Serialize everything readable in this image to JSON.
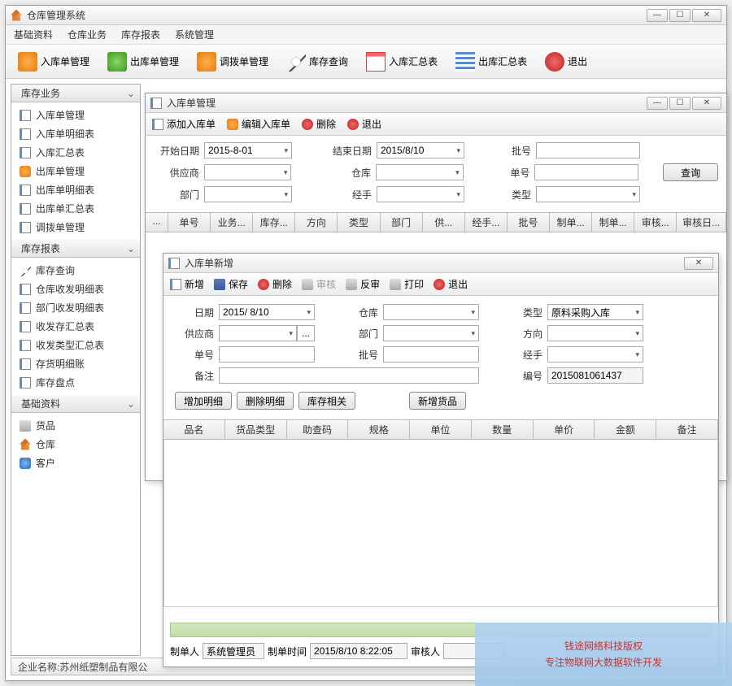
{
  "main": {
    "title": "仓库管理系统",
    "menu": [
      "基础资料",
      "仓库业务",
      "库存报表",
      "系统管理"
    ],
    "toolbar": [
      "入库单管理",
      "出库单管理",
      "调拨单管理",
      "库存查询",
      "入库汇总表",
      "出库汇总表",
      "退出"
    ],
    "statusbar": "企业名称:苏州纸塑制品有限公"
  },
  "sidebar": {
    "sections": [
      {
        "title": "库存业务",
        "items": [
          "入库单管理",
          "入库单明细表",
          "入库汇总表",
          "出库单管理",
          "出库单明细表",
          "出库单汇总表",
          "调拨单管理"
        ]
      },
      {
        "title": "库存报表",
        "items": [
          "库存查询",
          "仓库收发明细表",
          "部门收发明细表",
          "收发存汇总表",
          "收发类型汇总表",
          "存货明细账",
          "库存盘点"
        ]
      },
      {
        "title": "基础资料",
        "items": [
          "货品",
          "仓库",
          "客户"
        ]
      }
    ]
  },
  "win2": {
    "title": "入库单管理",
    "toolbar": [
      "添加入库单",
      "编辑入库单",
      "删除",
      "退出"
    ],
    "labels": {
      "start": "开始日期",
      "end": "结束日期",
      "batch": "批号",
      "supplier": "供应商",
      "warehouse": "仓库",
      "docno": "单号",
      "dept": "部门",
      "handler": "经手",
      "type": "类型",
      "query": "查询"
    },
    "values": {
      "start": "2015-8-01",
      "end": "2015/8/10"
    },
    "gridcols": [
      "...",
      "单号",
      "业务...",
      "库存...",
      "方向",
      "类型",
      "部门",
      "供...",
      "经手...",
      "批号",
      "制单...",
      "制单...",
      "审核...",
      "审核日..."
    ]
  },
  "win3": {
    "title": "入库单新增",
    "toolbar": [
      "新增",
      "保存",
      "删除",
      "审核",
      "反审",
      "打印",
      "退出"
    ],
    "labels": {
      "date": "日期",
      "warehouse": "仓库",
      "type": "类型",
      "supplier": "供应商",
      "dept": "部门",
      "direction": "方向",
      "docno": "单号",
      "batch": "批号",
      "handler": "经手",
      "remark": "备注",
      "code": "编号"
    },
    "values": {
      "date": "2015/ 8/10",
      "type": "原料采购入库",
      "code": "2015081061437"
    },
    "buttons": [
      "增加明细",
      "删除明细",
      "库存相关",
      "新增货品"
    ],
    "gridcols": [
      "品名",
      "货品类型",
      "助查码",
      "规格",
      "单位",
      "数量",
      "单价",
      "金额",
      "备注"
    ],
    "footer": {
      "maker": "制单人",
      "maker_val": "系统管理员",
      "maketime": "制单时间",
      "maketime_val": "2015/8/10 8:22:05",
      "auditor": "审核人"
    }
  },
  "watermark": {
    "l1": "钱途网络科技版权",
    "l2": "专注物联网大数据软件开发"
  }
}
